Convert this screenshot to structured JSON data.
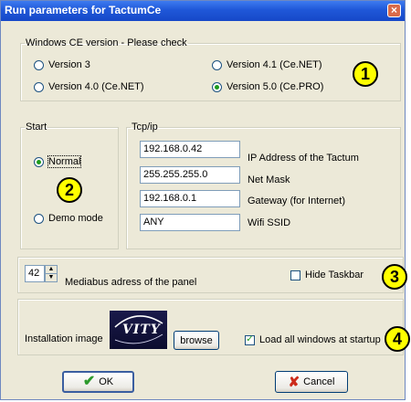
{
  "window": {
    "title": "Run parameters for TactumCe",
    "close": "×"
  },
  "version_group": {
    "legend": "Windows CE version - Please check",
    "options": [
      {
        "label": "Version 3",
        "selected": false
      },
      {
        "label": "Version 4.1 (Ce.NET)",
        "selected": false
      },
      {
        "label": "Version 4.0 (Ce.NET)",
        "selected": false
      },
      {
        "label": "Version 5.0 (Ce.PRO)",
        "selected": true
      }
    ]
  },
  "start_group": {
    "legend": "Start",
    "options": [
      {
        "label": "Normal",
        "selected": true
      },
      {
        "label": "Demo mode",
        "selected": false
      }
    ]
  },
  "tcp_group": {
    "legend": "Tcp/ip",
    "fields": [
      {
        "value": "192.168.0.42",
        "label": "IP Address of the Tactum"
      },
      {
        "value": "255.255.255.0",
        "label": "Net Mask"
      },
      {
        "value": "192.168.0.1",
        "label": "Gateway (for Internet)"
      },
      {
        "value": "ANY",
        "label": "Wifi SSID"
      }
    ]
  },
  "mediabus": {
    "value": "42",
    "label": "Mediabus adress of the panel"
  },
  "hide_taskbar": {
    "label": "Hide Taskbar",
    "checked": false
  },
  "install": {
    "label": "Installation image",
    "logo_text": "VITY",
    "browse_label": "browse",
    "load_all_label": "Load all windows at startup",
    "load_all_checked": true
  },
  "buttons": {
    "ok": "OK",
    "cancel": "Cancel"
  },
  "badges": [
    "1",
    "2",
    "3",
    "4"
  ],
  "colors": {
    "badge_fill": "#ffff00",
    "title_bar": "#1f57d8",
    "dialog_bg": "#ece9d8"
  }
}
